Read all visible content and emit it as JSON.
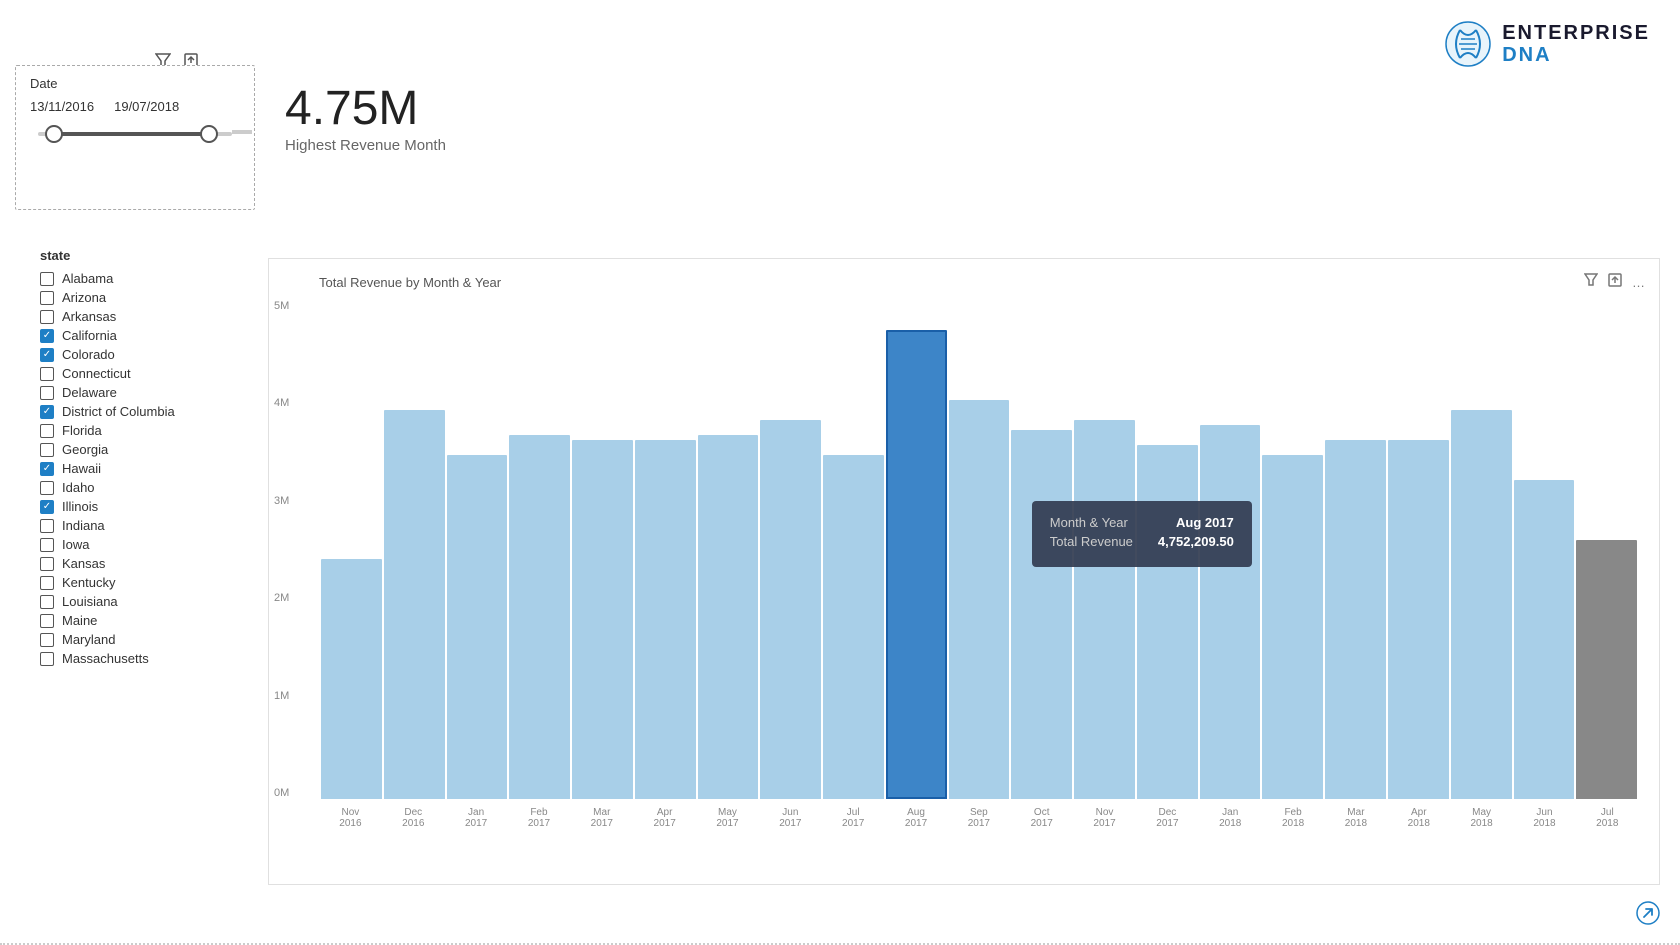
{
  "logo": {
    "text_enterprise": "ENTERPRISE",
    "text_dna": " DNA"
  },
  "toolbar": {
    "filter_icon": "⊿",
    "export_icon": "⬜",
    "more_icon": "…"
  },
  "date_widget": {
    "label": "Date",
    "start": "13/11/2016",
    "end": "19/07/2018"
  },
  "metric": {
    "value": "4.75M",
    "label": "Highest Revenue Month"
  },
  "state_filter": {
    "title": "state",
    "items": [
      {
        "name": "Alabama",
        "checked": false
      },
      {
        "name": "Arizona",
        "checked": false
      },
      {
        "name": "Arkansas",
        "checked": false
      },
      {
        "name": "California",
        "checked": true
      },
      {
        "name": "Colorado",
        "checked": true
      },
      {
        "name": "Connecticut",
        "checked": false
      },
      {
        "name": "Delaware",
        "checked": false
      },
      {
        "name": "District of Columbia",
        "checked": true
      },
      {
        "name": "Florida",
        "checked": false
      },
      {
        "name": "Georgia",
        "checked": false
      },
      {
        "name": "Hawaii",
        "checked": true
      },
      {
        "name": "Idaho",
        "checked": false
      },
      {
        "name": "Illinois",
        "checked": true
      },
      {
        "name": "Indiana",
        "checked": false
      },
      {
        "name": "Iowa",
        "checked": false
      },
      {
        "name": "Kansas",
        "checked": false
      },
      {
        "name": "Kentucky",
        "checked": false
      },
      {
        "name": "Louisiana",
        "checked": false
      },
      {
        "name": "Maine",
        "checked": false
      },
      {
        "name": "Maryland",
        "checked": false
      },
      {
        "name": "Massachusetts",
        "checked": false
      }
    ]
  },
  "chart": {
    "title": "Total Revenue by Month & Year",
    "y_labels": [
      "0M",
      "1M",
      "2M",
      "3M",
      "4M",
      "5M"
    ],
    "bars": [
      {
        "label": "Nov\n2016",
        "height_pct": 48,
        "highlighted": false,
        "dark": false
      },
      {
        "label": "Dec\n2016",
        "height_pct": 78,
        "highlighted": false,
        "dark": false
      },
      {
        "label": "Jan\n2017",
        "height_pct": 69,
        "highlighted": false,
        "dark": false
      },
      {
        "label": "Feb\n2017",
        "height_pct": 73,
        "highlighted": false,
        "dark": false
      },
      {
        "label": "Mar\n2017",
        "height_pct": 72,
        "highlighted": false,
        "dark": false
      },
      {
        "label": "Apr\n2017",
        "height_pct": 72,
        "highlighted": false,
        "dark": false
      },
      {
        "label": "May\n2017",
        "height_pct": 73,
        "highlighted": false,
        "dark": false
      },
      {
        "label": "Jun\n2017",
        "height_pct": 76,
        "highlighted": false,
        "dark": false
      },
      {
        "label": "Jul\n2017",
        "height_pct": 69,
        "highlighted": false,
        "dark": false
      },
      {
        "label": "Aug\n2017",
        "height_pct": 94,
        "highlighted": true,
        "dark": false
      },
      {
        "label": "Sep\n2017",
        "height_pct": 80,
        "highlighted": false,
        "dark": false
      },
      {
        "label": "Oct\n2017",
        "height_pct": 74,
        "highlighted": false,
        "dark": false
      },
      {
        "label": "Nov\n2017",
        "height_pct": 76,
        "highlighted": false,
        "dark": false
      },
      {
        "label": "Dec\n2017",
        "height_pct": 71,
        "highlighted": false,
        "dark": false
      },
      {
        "label": "Jan\n2018",
        "height_pct": 75,
        "highlighted": false,
        "dark": false
      },
      {
        "label": "Feb\n2018",
        "height_pct": 69,
        "highlighted": false,
        "dark": false
      },
      {
        "label": "Mar\n2018",
        "height_pct": 72,
        "highlighted": false,
        "dark": false
      },
      {
        "label": "Apr\n2018",
        "height_pct": 72,
        "highlighted": false,
        "dark": false
      },
      {
        "label": "May\n2018",
        "height_pct": 78,
        "highlighted": false,
        "dark": false
      },
      {
        "label": "Jun\n2018",
        "height_pct": 64,
        "highlighted": false,
        "dark": false
      },
      {
        "label": "Jul\n2018",
        "height_pct": 52,
        "highlighted": false,
        "dark": true
      }
    ],
    "tooltip": {
      "key1": "Month & Year",
      "val1": "Aug 2017",
      "key2": "Total Revenue",
      "val2": "4,752,209.50"
    }
  },
  "subscribe": "↗"
}
